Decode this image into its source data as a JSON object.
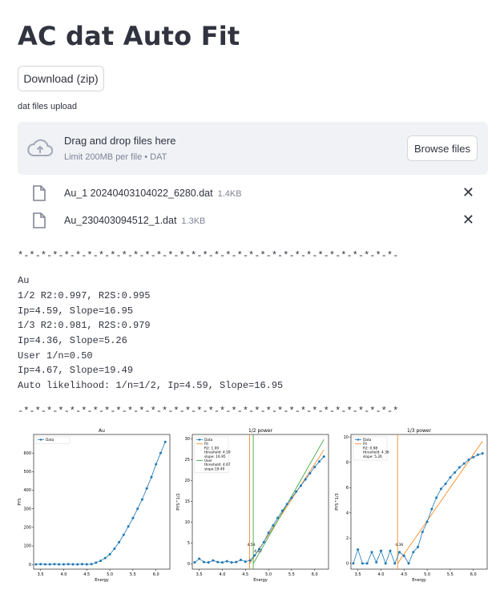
{
  "page": {
    "title": "AC dat Auto Fit",
    "download_label": "Download (zip)",
    "upload_label": "dat files upload"
  },
  "uploader": {
    "drag_text": "Drag and drop files here",
    "limit_text": "Limit 200MB per file • DAT",
    "browse_label": "Browse files",
    "files": [
      {
        "name": "Au_1 20240403104022_6280.dat",
        "size": "1.4KB"
      },
      {
        "name": "Au_230403094512_1.dat",
        "size": "1.3KB"
      }
    ]
  },
  "results": {
    "sep_top": "*-*-*-*-*-*-*-*-*-*-*-*-*-*-*-*-*-*-*-*-*-*-*-*-*-*-*-*-*-*-*-*-*-",
    "lines": [
      "Au",
      "1/2 R2:0.997, R2S:0.995",
      "Ip=4.59, Slope=16.95",
      "1/3 R2:0.981, R2S:0.979",
      "Ip=4.36, Slope=5.26",
      "User 1/n=0.50",
      "Ip=4.67, Slope=19.49",
      "Auto likelihood: 1/n=1/2, Ip=4.59, Slope=16.95"
    ],
    "sep_bottom": "-*-*-*-*-*-*-*-*-*-*-*-*-*-*-*-*-*-*-*-*-*-*-*-*-*-*-*-*-*-*-*-*-*"
  },
  "chart_data": [
    {
      "type": "line",
      "title": "Au",
      "xlabel": "Energy",
      "ylabel": "PYS",
      "xlim": [
        3.35,
        6.3
      ],
      "ylim": [
        -25,
        700
      ],
      "xticks": [
        3.5,
        4.0,
        4.5,
        5.0,
        5.5,
        6.0
      ],
      "yticks": [
        0,
        100,
        200,
        300,
        400,
        500,
        600
      ],
      "legend": [
        "Data"
      ],
      "legend_position": "top-left",
      "colors": {
        "data": "#1f77b4"
      },
      "x": [
        3.4,
        3.5,
        3.6,
        3.7,
        3.8,
        3.9,
        4.0,
        4.1,
        4.2,
        4.3,
        4.4,
        4.5,
        4.6,
        4.7,
        4.8,
        4.9,
        5.0,
        5.1,
        5.2,
        5.3,
        5.4,
        5.5,
        5.6,
        5.7,
        5.8,
        5.9,
        6.0,
        6.1,
        6.2
      ],
      "y": [
        1,
        2,
        1,
        1,
        2,
        1,
        1,
        2,
        1,
        1,
        2,
        1,
        2,
        10,
        20,
        35,
        55,
        85,
        120,
        160,
        205,
        250,
        300,
        350,
        410,
        470,
        540,
        600,
        660
      ]
    },
    {
      "type": "line",
      "title": "1/2 power",
      "xlabel": "Energy",
      "ylabel": "PYS^1/2",
      "xlim": [
        3.35,
        6.3
      ],
      "ylim": [
        -1.3,
        31
      ],
      "xticks": [
        3.5,
        4.0,
        4.5,
        5.0,
        5.5,
        6.0
      ],
      "yticks": [
        0,
        5,
        10,
        15,
        20,
        25,
        30
      ],
      "legend": [
        "Data",
        "Fit",
        "R2: 1.00",
        "threshold: 4.59",
        "slope: 16.95",
        "User",
        "threshold: 4.67",
        "slope:19.49"
      ],
      "legend_position": "top-left",
      "annotations": [
        "4.59",
        "4.67"
      ],
      "colors": {
        "data": "#1f77b4",
        "fit": "#ff7f0e",
        "user": "#2ca02c"
      },
      "x": [
        3.4,
        3.5,
        3.6,
        3.7,
        3.8,
        3.9,
        4.0,
        4.1,
        4.2,
        4.3,
        4.4,
        4.5,
        4.6,
        4.7,
        4.8,
        4.9,
        5.0,
        5.1,
        5.2,
        5.3,
        5.4,
        5.5,
        5.6,
        5.7,
        5.8,
        5.9,
        6.0,
        6.1,
        6.2
      ],
      "y": [
        0.3,
        1.2,
        0.4,
        0.3,
        0.8,
        0.4,
        0.3,
        0.6,
        0.3,
        0.4,
        0.9,
        0.5,
        0.8,
        2.0,
        3.5,
        5.2,
        7.4,
        9.2,
        11.0,
        12.7,
        14.3,
        15.8,
        17.3,
        18.7,
        20.2,
        21.7,
        23.2,
        24.5,
        25.7
      ],
      "fit": {
        "threshold": 4.59,
        "slope": 16.95,
        "R2": 1.0
      },
      "user": {
        "threshold": 4.67,
        "slope": 19.49
      }
    },
    {
      "type": "line",
      "title": "1/3 power",
      "xlabel": "Energy",
      "ylabel": "PYS^1/3",
      "xlim": [
        3.35,
        6.3
      ],
      "ylim": [
        -0.45,
        10.2
      ],
      "xticks": [
        3.5,
        4.0,
        4.5,
        5.0,
        5.5,
        6.0
      ],
      "yticks": [
        0,
        2,
        4,
        6,
        8,
        10
      ],
      "legend": [
        "Data",
        "Fit",
        "R2: 0.98",
        "threshold: 4.36",
        "slope: 5.26"
      ],
      "legend_position": "top-left",
      "annotations": [
        "4.36"
      ],
      "colors": {
        "data": "#1f77b4",
        "fit": "#ff7f0e"
      },
      "x": [
        3.4,
        3.5,
        3.6,
        3.7,
        3.8,
        3.9,
        4.0,
        4.1,
        4.2,
        4.3,
        4.4,
        4.5,
        4.6,
        4.7,
        4.8,
        4.9,
        5.0,
        5.1,
        5.2,
        5.3,
        5.4,
        5.5,
        5.6,
        5.7,
        5.8,
        5.9,
        6.0,
        6.1,
        6.2
      ],
      "y": [
        0.0,
        1.1,
        0.0,
        0.0,
        0.9,
        0.1,
        1.0,
        0.0,
        1.0,
        0.0,
        0.9,
        0.6,
        0.0,
        0.9,
        1.3,
        2.5,
        3.3,
        4.3,
        5.2,
        5.9,
        6.3,
        6.8,
        7.2,
        7.6,
        7.9,
        8.2,
        8.4,
        8.6,
        8.7
      ],
      "fit": {
        "threshold": 4.36,
        "slope": 5.26,
        "R2": 0.98
      }
    }
  ]
}
